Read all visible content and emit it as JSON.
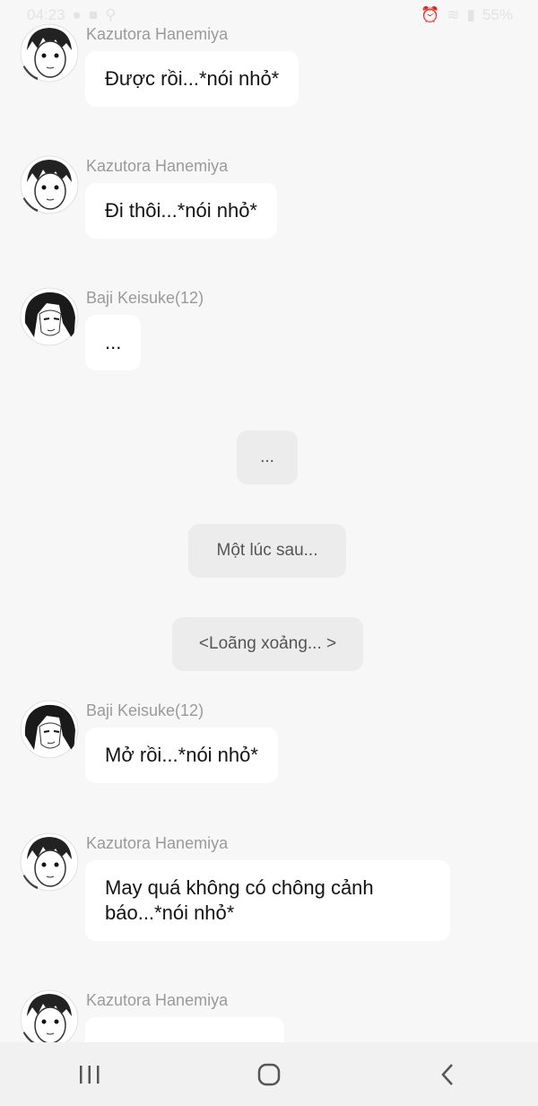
{
  "status_bar": {
    "time": "04:23",
    "battery": "55%"
  },
  "messages": [
    {
      "sender": "Kazutora Hanemiya",
      "text": "Được rồi...*nói nhỏ*",
      "avatar": "kazutora-avatar"
    },
    {
      "sender": "Kazutora Hanemiya",
      "text": "Đi thôi...*nói nhỏ*",
      "avatar": "kazutora-avatar"
    },
    {
      "sender": "Baji Keisuke(12)",
      "text": "...",
      "avatar": "baji-avatar"
    },
    {
      "sender": "Baji Keisuke(12)",
      "text": "Mở rồi...*nói nhỏ*",
      "avatar": "baji-avatar"
    },
    {
      "sender": "Kazutora Hanemiya",
      "text": "May quá không có chông cảnh\nbáo...*nói nhỏ*",
      "avatar": "kazutora-avatar"
    },
    {
      "sender": "Kazutora Hanemiya",
      "text": "",
      "avatar": "kazutora-avatar"
    }
  ],
  "system_notes": [
    {
      "text": "..."
    },
    {
      "text": "Một lúc sau..."
    },
    {
      "text": "<Loãng xoảng... >"
    }
  ],
  "nav": {
    "recent": "recent-apps-icon",
    "home": "home-icon",
    "back": "back-icon"
  }
}
